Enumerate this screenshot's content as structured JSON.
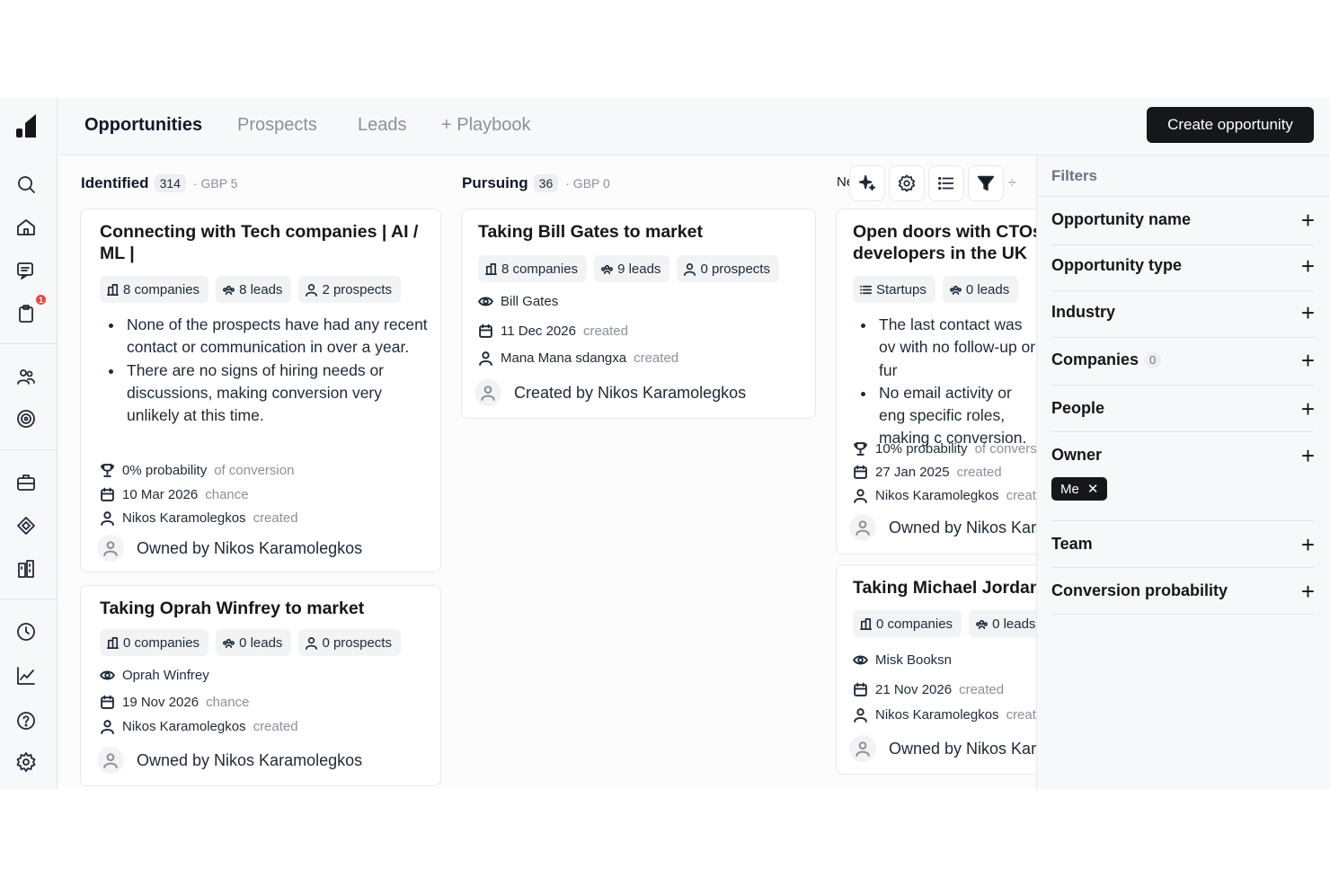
{
  "nav": {
    "tabs": [
      "Opportunities",
      "Prospects",
      "Leads",
      "+ Playbook"
    ],
    "create_button": "Create opportunity",
    "notification_count": "1",
    "sidebar_icons": [
      "search-icon",
      "home-icon",
      "chat-icon",
      "clipboard-icon",
      "people-icon",
      "target-icon",
      "briefcase-icon",
      "diamond-icon",
      "buildings-icon",
      "clock-icon",
      "chart-icon",
      "help-icon",
      "settings-icon"
    ]
  },
  "columns": [
    {
      "title": "Identified",
      "count": "314",
      "meta": "· GBP 5",
      "cards": [
        {
          "title_lines": [
            "Connecting with Tech companies | AI /",
            "ML |"
          ],
          "chips": [
            "8 companies",
            "8 leads",
            "2 prospects"
          ],
          "bullets": [
            "None of the prospects have had any recent contact or communication in over a year.",
            "There are no signs of hiring needs or discussions, making conversion very unlikely at this time."
          ],
          "probability": "0% probability",
          "probability_suffix": "of conversion",
          "date": "10 Mar 2026",
          "date_suffix": "chance",
          "creator": "Nikos Karamolegkos",
          "creator_suffix": "created",
          "owner": "Owned by Nikos Karamolegkos"
        },
        {
          "title": "Taking Oprah Winfrey to market",
          "chips": [
            "0 companies",
            "0 leads",
            "0 prospects"
          ],
          "watcher": "Oprah Winfrey",
          "date": "19 Nov 2026",
          "date_suffix": "chance",
          "creator": "Nikos Karamolegkos",
          "creator_suffix": "created",
          "owner": "Owned by Nikos Karamolegkos"
        }
      ]
    },
    {
      "title": "Pursuing",
      "count": "36",
      "meta": "· GBP 0",
      "cards": [
        {
          "title": "Taking Bill Gates to market",
          "chips": [
            "8 companies",
            "9 leads",
            "0 prospects"
          ],
          "watcher": "Bill Gates",
          "date": "11 Dec 2026",
          "date_suffix": "created",
          "creator": "Mana Mana sdangxa",
          "creator_suffix": "created",
          "owner": "Created by Nikos Karamolegkos"
        }
      ]
    },
    {
      "title": "Ne",
      "cards": [
        {
          "title_lines": [
            "Open doors with CTOs",
            "developers in the UK"
          ],
          "chips": [
            "Startups",
            "0 leads"
          ],
          "bullets": [
            "The last contact was ov with no follow-up or fur",
            "No email activity or eng specific roles, making c conversion."
          ],
          "probability": "10% probability",
          "probability_suffix": "of conversic",
          "date": "27 Jan 2025",
          "date_suffix": "created",
          "creator": "Nikos Karamolegkos",
          "creator_suffix": "create",
          "owner": "Owned by Nikos Karar"
        },
        {
          "title": "Taking Michael Jordan",
          "chips": [
            "0 companies",
            "0 leads"
          ],
          "watcher": "Misk Booksn",
          "date": "21 Nov 2026",
          "date_suffix": "created",
          "creator": "Nikos Karamolegkos",
          "creator_suffix": "create",
          "owner": "Owned by Nikos Karar"
        }
      ]
    }
  ],
  "filters": {
    "title": "Filters",
    "items": [
      "Opportunity name",
      "Opportunity type",
      "Industry",
      "Companies",
      "People",
      "Owner",
      "Team",
      "Conversion probability"
    ],
    "companies_badge": "0",
    "owner_pill": "Me",
    "owner_pill_remove": "✕",
    "plus": "+"
  }
}
